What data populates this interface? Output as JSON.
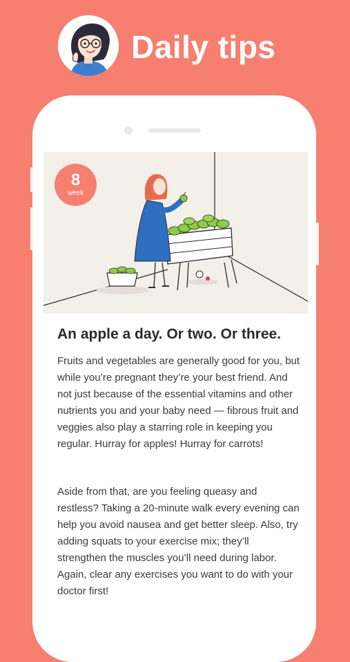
{
  "header": {
    "title": "Daily tips"
  },
  "colors": {
    "background": "#f67f6f",
    "phone": "#ffffff",
    "illustration_bg": "#f3efe9",
    "badge": "#f67f6f",
    "text": "#3a3a3a"
  },
  "badge": {
    "number": "8",
    "label": "week"
  },
  "icons": {
    "avatar": "woman-avatar-icon",
    "illustration": "pregnant-woman-eating-apples-illustration"
  },
  "article": {
    "title": "An apple a day. Or two. Or three.",
    "paragraphs": [
      "Fruits and vegetables are generally good for you, but while you’re pregnant they’re your best friend. And not just because of the essential vitamins and other nutrients you and your baby need — fibrous fruit and veggies also play a starring role in keeping you regular. Hurray for apples! Hurray for carrots!",
      "Aside from that, are you feeling queasy and restless? Taking a 20-minute walk every evening can help you avoid nausea and get better sleep. Also, try adding squats to your exercise mix; they’ll strengthen the muscles you’ll need during labor. Again, clear any exercises you want to do with your doctor first!"
    ]
  }
}
